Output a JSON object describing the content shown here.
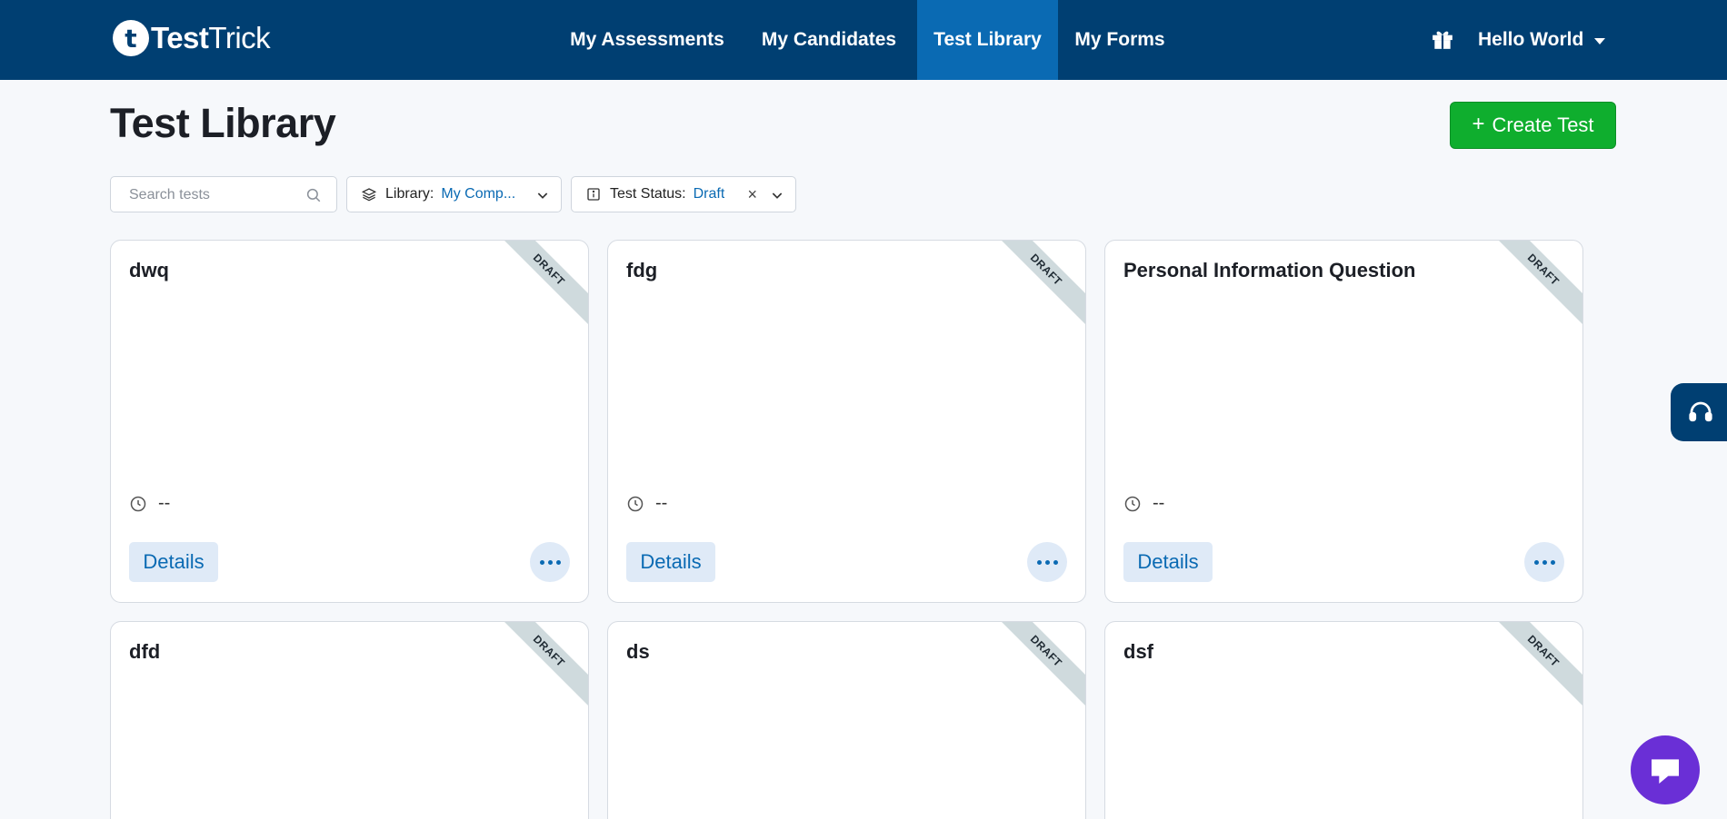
{
  "brand": {
    "logo_letter": "t",
    "name_bold": "Test",
    "name_light": "Trick"
  },
  "nav": {
    "items": [
      {
        "label": "My Assessments",
        "active": false
      },
      {
        "label": "My Candidates",
        "active": false
      },
      {
        "label": "Test Library",
        "active": true
      },
      {
        "label": "My Forms",
        "active": false
      }
    ],
    "user_label": "Hello World"
  },
  "page": {
    "title": "Test Library",
    "create_label": "Create Test",
    "create_plus": "+"
  },
  "filters": {
    "search_placeholder": "Search tests",
    "library_label": "Library:",
    "library_value": "My Comp...",
    "status_label": "Test Status:",
    "status_value": "Draft",
    "clear_glyph": "×"
  },
  "cards": [
    {
      "title": "dwq",
      "ribbon": "DRAFT",
      "duration": "--",
      "details_label": "Details"
    },
    {
      "title": "fdg",
      "ribbon": "DRAFT",
      "duration": "--",
      "details_label": "Details"
    },
    {
      "title": "Personal Information Question",
      "ribbon": "DRAFT",
      "duration": "--",
      "details_label": "Details"
    },
    {
      "title": "dfd",
      "ribbon": "DRAFT",
      "duration": "--",
      "details_label": "Details"
    },
    {
      "title": "ds",
      "ribbon": "DRAFT",
      "duration": "--",
      "details_label": "Details"
    },
    {
      "title": "dsf",
      "ribbon": "DRAFT",
      "duration": "--",
      "details_label": "Details"
    }
  ],
  "colors": {
    "topbar": "#003f72",
    "nav_active": "#0a6ab3",
    "create_button": "#0fae2e",
    "link_blue": "#0a6ab3",
    "chat_purple": "#6a2fd6"
  },
  "icons": {
    "search": "search-icon",
    "library": "layers-icon",
    "status": "info-icon",
    "chevron": "chevron-down-icon",
    "duration": "clock-icon",
    "more": "more-horizontal-icon",
    "gift": "gift-icon",
    "support": "headset-icon",
    "chat": "chat-icon"
  }
}
